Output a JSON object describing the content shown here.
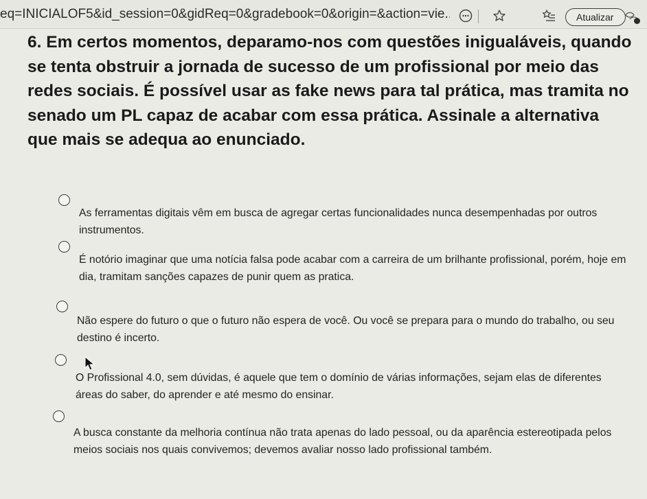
{
  "browser": {
    "url": "eq=INICIALOF5&id_session=0&gidReq=0&gradebook=0&origin=&action=vie...",
    "update_label": "Atualizar",
    "icons": [
      "more-icon",
      "star-icon",
      "favorites-icon",
      "menu-icon"
    ]
  },
  "question": {
    "text": "6. Em certos momentos, deparamo-nos com questões inigualáveis, quando se tenta obstruir a jornada de sucesso de um profissional por meio das redes sociais. É possível usar as fake news para tal prática, mas tramita no senado um PL capaz de acabar com essa prática. Assinale a alternativa que mais se adequa ao enunciado."
  },
  "options": [
    {
      "text": "As ferramentas digitais vêm em busca de agregar certas funcionalidades nunca desempenhadas por outros instrumentos."
    },
    {
      "text": "É notório imaginar que uma notícia falsa pode acabar com a carreira de um brilhante profissional, porém, hoje em dia, tramitam sanções capazes de punir quem as pratica."
    },
    {
      "text": "Não espere do futuro o que o futuro não espera de você. Ou você se prepara para o mundo do trabalho, ou seu destino é incerto."
    },
    {
      "text": "O Profissional 4.0, sem dúvidas, é aquele que tem o domínio de várias informações, sejam elas de diferentes áreas do saber, do aprender e até mesmo do ensinar."
    },
    {
      "text": "A busca constante da melhoria contínua não trata apenas do lado pessoal, ou da aparência estereotipada pelos meios sociais nos quais convivemos; devemos avaliar nosso lado profissional também."
    }
  ]
}
